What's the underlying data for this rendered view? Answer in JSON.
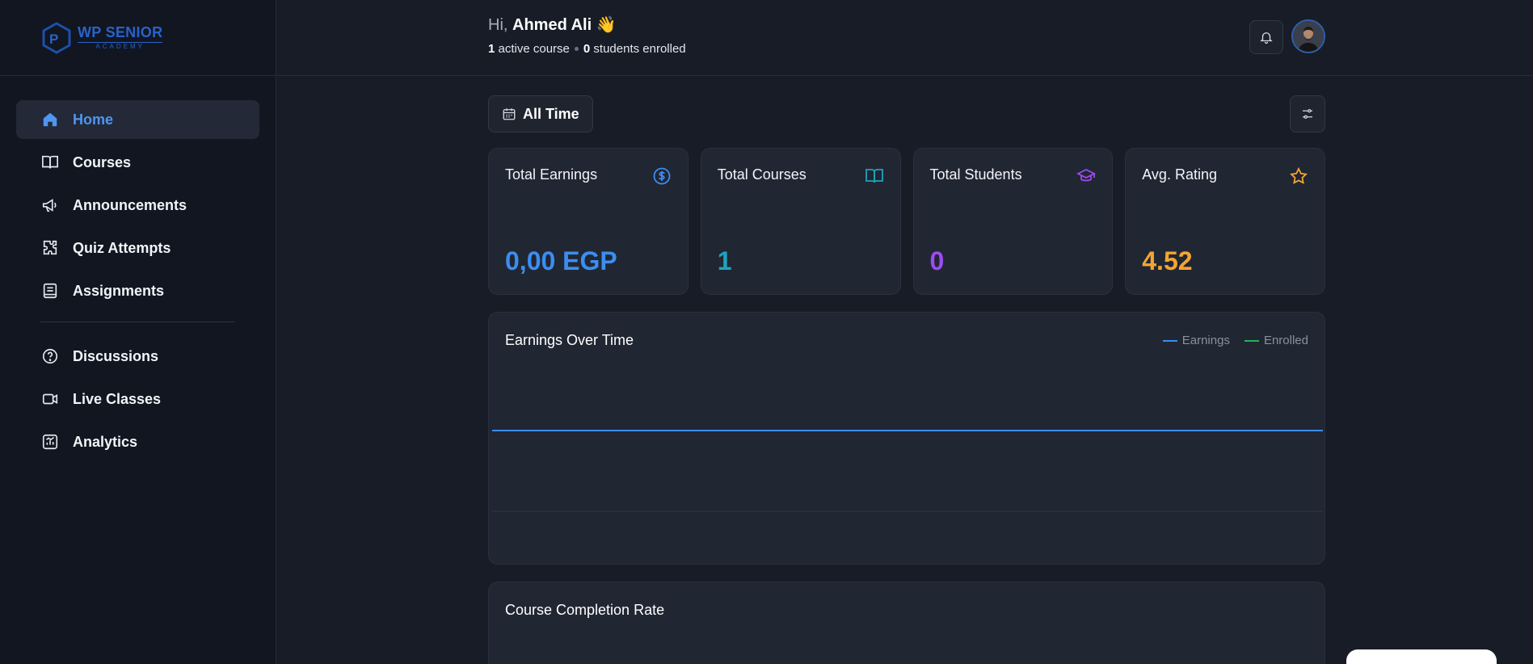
{
  "sidebar": {
    "logo": {
      "line1": "WP SENIOR",
      "line2": "ACADEMY"
    },
    "items": [
      {
        "label": "Home",
        "icon": "home-icon",
        "active": true
      },
      {
        "label": "Courses",
        "icon": "book-icon"
      },
      {
        "label": "Announcements",
        "icon": "megaphone-icon"
      },
      {
        "label": "Quiz Attempts",
        "icon": "puzzle-icon"
      },
      {
        "label": "Assignments",
        "icon": "notebook-icon"
      },
      {
        "label": "Discussions",
        "icon": "help-circle-icon"
      },
      {
        "label": "Live Classes",
        "icon": "video-icon"
      },
      {
        "label": "Analytics",
        "icon": "chart-icon"
      }
    ]
  },
  "header": {
    "hi": "Hi,",
    "name": "Ahmed Ali",
    "wave": "👋",
    "active_count": "1",
    "active_text": "active course",
    "students_count": "0",
    "students_text": "students enrolled"
  },
  "toolbar": {
    "time_label": "All Time"
  },
  "stats": [
    {
      "title": "Total Earnings",
      "value": "0,00 EGP",
      "color": "#3b8ef0",
      "icon": "dollar-circle-icon"
    },
    {
      "title": "Total Courses",
      "value": "1",
      "color": "#1fa3bd",
      "icon": "open-book-icon"
    },
    {
      "title": "Total Students",
      "value": "0",
      "color": "#9b4cf2",
      "icon": "graduation-cap-icon"
    },
    {
      "title": "Avg. Rating",
      "value": "4.52",
      "color": "#f3a531",
      "icon": "star-icon"
    }
  ],
  "earnings_panel": {
    "title": "Earnings Over Time",
    "legend": [
      {
        "name": "Earnings",
        "color": "#3b8ef0"
      },
      {
        "name": "Enrolled",
        "color": "#22b35a"
      }
    ]
  },
  "completion_panel": {
    "title": "Course Completion Rate"
  },
  "chart_data": {
    "type": "line",
    "title": "Earnings Over Time",
    "series": [
      {
        "name": "Earnings",
        "values": [
          0,
          0
        ]
      },
      {
        "name": "Enrolled",
        "values": [
          0,
          0
        ]
      }
    ],
    "grid": false,
    "legend": "top-right"
  }
}
